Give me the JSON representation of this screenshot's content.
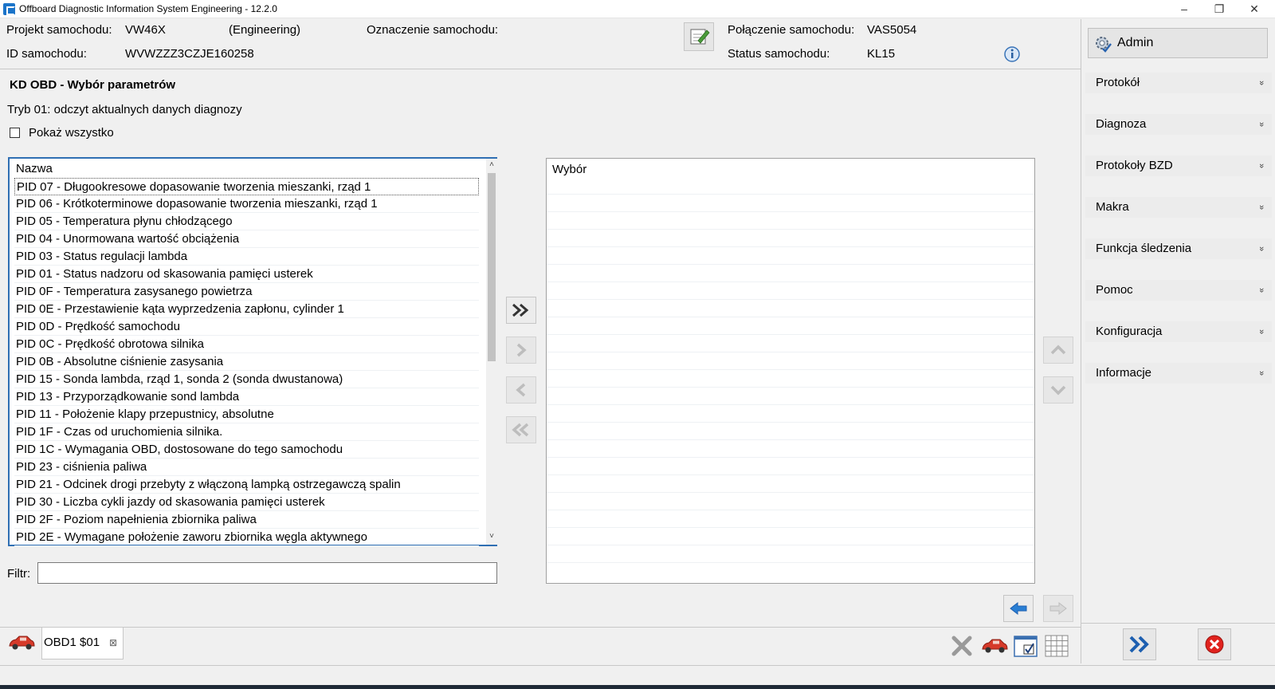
{
  "window": {
    "title": "Offboard Diagnostic Information System Engineering - 12.2.0",
    "minimize": "–",
    "maximize": "❐",
    "close": "✕"
  },
  "header": {
    "project_label": "Projekt samochodu:",
    "project_value": "VW46X",
    "project_mode": "(Engineering)",
    "designation_label": "Oznaczenie samochodu:",
    "id_label": "ID samochodu:",
    "id_value": "WVWZZZ3CZJE160258",
    "connection_label": "Połączenie samochodu:",
    "connection_value": "VAS5054",
    "status_label": "Status samochodu:",
    "status_value": "KL15"
  },
  "main": {
    "title": "KD OBD - Wybór parametrów",
    "mode_text": "Tryb 01: odczyt aktualnych danych diagnozy",
    "show_all_label": "Pokaż wszystko",
    "list_header": "Nazwa",
    "list_items": [
      "PID 07 - Długookresowe dopasowanie tworzenia mieszanki, rząd 1",
      "PID 06 - Krótkoterminowe dopasowanie tworzenia mieszanki, rząd 1",
      "PID 05 - Temperatura płynu chłodzącego",
      "PID 04 - Unormowana wartość obciążenia",
      "PID 03 - Status regulacji lambda",
      "PID 01 - Status nadzoru od skasowania pamięci usterek",
      "PID 0F - Temperatura zasysanego powietrza",
      "PID 0E - Przestawienie kąta wyprzedzenia zapłonu, cylinder 1",
      "PID 0D - Prędkość samochodu",
      "PID 0C - Prędkość obrotowa silnika",
      "PID 0B - Absolutne ciśnienie zasysania",
      "PID 15 - Sonda lambda, rząd 1, sonda 2 (sonda dwustanowa)",
      "PID 13 - Przyporządkowanie sond lambda",
      "PID 11 - Położenie klapy przepustnicy, absolutne",
      "PID 1F - Czas od uruchomienia silnika.",
      "PID 1C - Wymagania OBD, dostosowane do tego samochodu",
      "PID 23 - ciśnienia paliwa",
      "PID 21 - Odcinek drogi przebyty z włączoną lampką ostrzegawczą spalin",
      "PID 30 - Liczba cykli jazdy od skasowania pamięci usterek",
      "PID 2F - Poziom napełnienia zbiornika paliwa",
      "PID 2E - Wymagane położenie zaworu zbiornika węgla aktywnego"
    ],
    "selection_header": "Wybór",
    "filter_label": "Filtr:",
    "filter_value": ""
  },
  "tabs": [
    {
      "label": "OBD1 $01",
      "close": "⊠"
    }
  ],
  "sidebar": {
    "admin_label": "Admin",
    "menu": [
      {
        "label": "Protokół"
      },
      {
        "label": "Diagnoza"
      },
      {
        "label": "Protokoły BZD"
      },
      {
        "label": "Makra"
      },
      {
        "label": "Funkcja śledzenia"
      },
      {
        "label": "Pomoc"
      },
      {
        "label": "Konfiguracja"
      },
      {
        "label": "Informacje"
      }
    ],
    "chevron": "»"
  },
  "colors": {
    "accent": "#2f6fb3",
    "arrow_blue": "#1d5fb0",
    "disabled_icon": "#bdbdbd",
    "close_red": "#e0221d"
  }
}
